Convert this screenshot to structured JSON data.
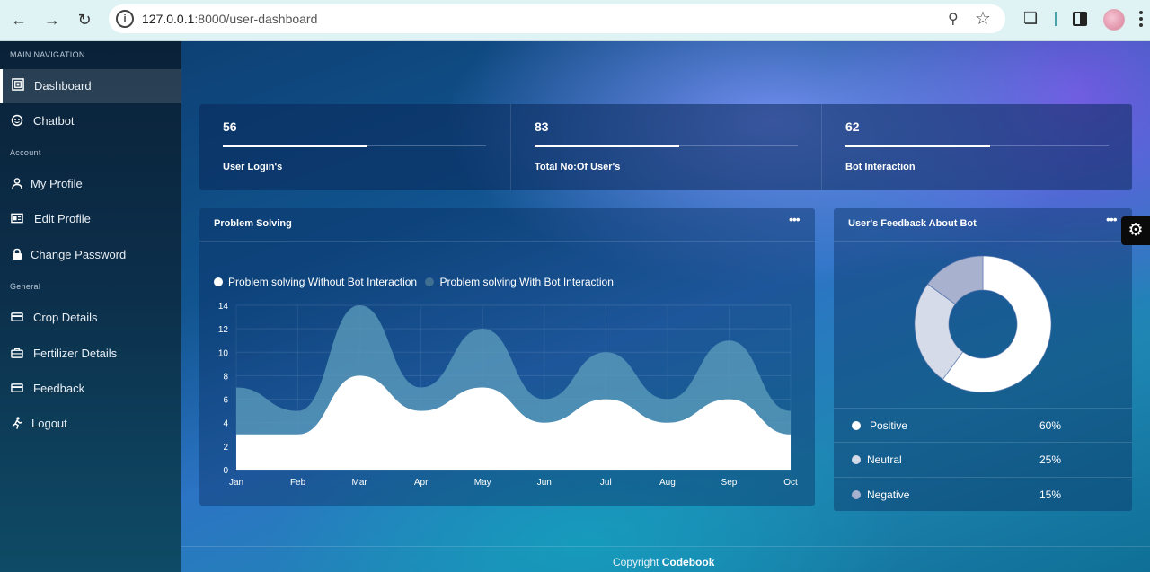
{
  "browser": {
    "url_host": "127.0.0.1",
    "url_path": ":8000/user-dashboard"
  },
  "sidebar": {
    "main_label": "MAIN NAVIGATION",
    "account_label": "Account",
    "general_label": "General",
    "items": [
      {
        "label": "Dashboard",
        "icon": "dashboard-icon"
      },
      {
        "label": "Chatbot",
        "icon": "chatbot-icon"
      },
      {
        "label": "My Profile",
        "icon": "user-icon"
      },
      {
        "label": "Edit Profile",
        "icon": "id-card-icon"
      },
      {
        "label": "Change Password",
        "icon": "lock-icon"
      },
      {
        "label": "Crop Details",
        "icon": "card-icon"
      },
      {
        "label": "Fertilizer Details",
        "icon": "briefcase-icon"
      },
      {
        "label": "Feedback",
        "icon": "card-icon"
      },
      {
        "label": "Logout",
        "icon": "running-icon"
      }
    ]
  },
  "stats": [
    {
      "value": "56",
      "label": "User Login's",
      "progress": 0.55
    },
    {
      "value": "83",
      "label": "Total No:Of User's",
      "progress": 0.55
    },
    {
      "value": "62",
      "label": "Bot Interaction",
      "progress": 0.55
    }
  ],
  "problem_card": {
    "title": "Problem Solving"
  },
  "feedback_card": {
    "title": "User's Feedback About Bot",
    "rows": [
      {
        "name": "Positive",
        "pct": "60%",
        "color": "#ffffff"
      },
      {
        "name": "Neutral",
        "pct": "25%",
        "color": "#d5dbe8"
      },
      {
        "name": "Negative",
        "pct": "15%",
        "color": "#a8b2cf"
      }
    ]
  },
  "footer": {
    "prefix": "Copyright",
    "brand": "Codebook"
  },
  "chart_data": [
    {
      "type": "area",
      "categories": [
        "Jan",
        "Feb",
        "Mar",
        "Apr",
        "May",
        "Jun",
        "Jul",
        "Aug",
        "Sep",
        "Oct"
      ],
      "series": [
        {
          "name": "Problem solving Without Bot Interaction",
          "values": [
            3,
            3,
            8,
            5,
            7,
            4,
            6,
            4,
            6,
            3
          ],
          "color": "#ffffff"
        },
        {
          "name": "Problem solving With Bot Interaction",
          "values": [
            7,
            5,
            14,
            7,
            12,
            6,
            10,
            6,
            11,
            5
          ],
          "color": "#5f9fbd"
        }
      ],
      "ylim": [
        0,
        14
      ],
      "yticks": [
        0,
        2,
        4,
        6,
        8,
        10,
        12,
        14
      ],
      "grid": true,
      "legend": "top-left"
    },
    {
      "type": "pie",
      "categories": [
        "Positive",
        "Neutral",
        "Negative"
      ],
      "values": [
        60,
        25,
        15
      ],
      "colors": [
        "#ffffff",
        "#d5dbe8",
        "#a8b2cf"
      ]
    }
  ]
}
